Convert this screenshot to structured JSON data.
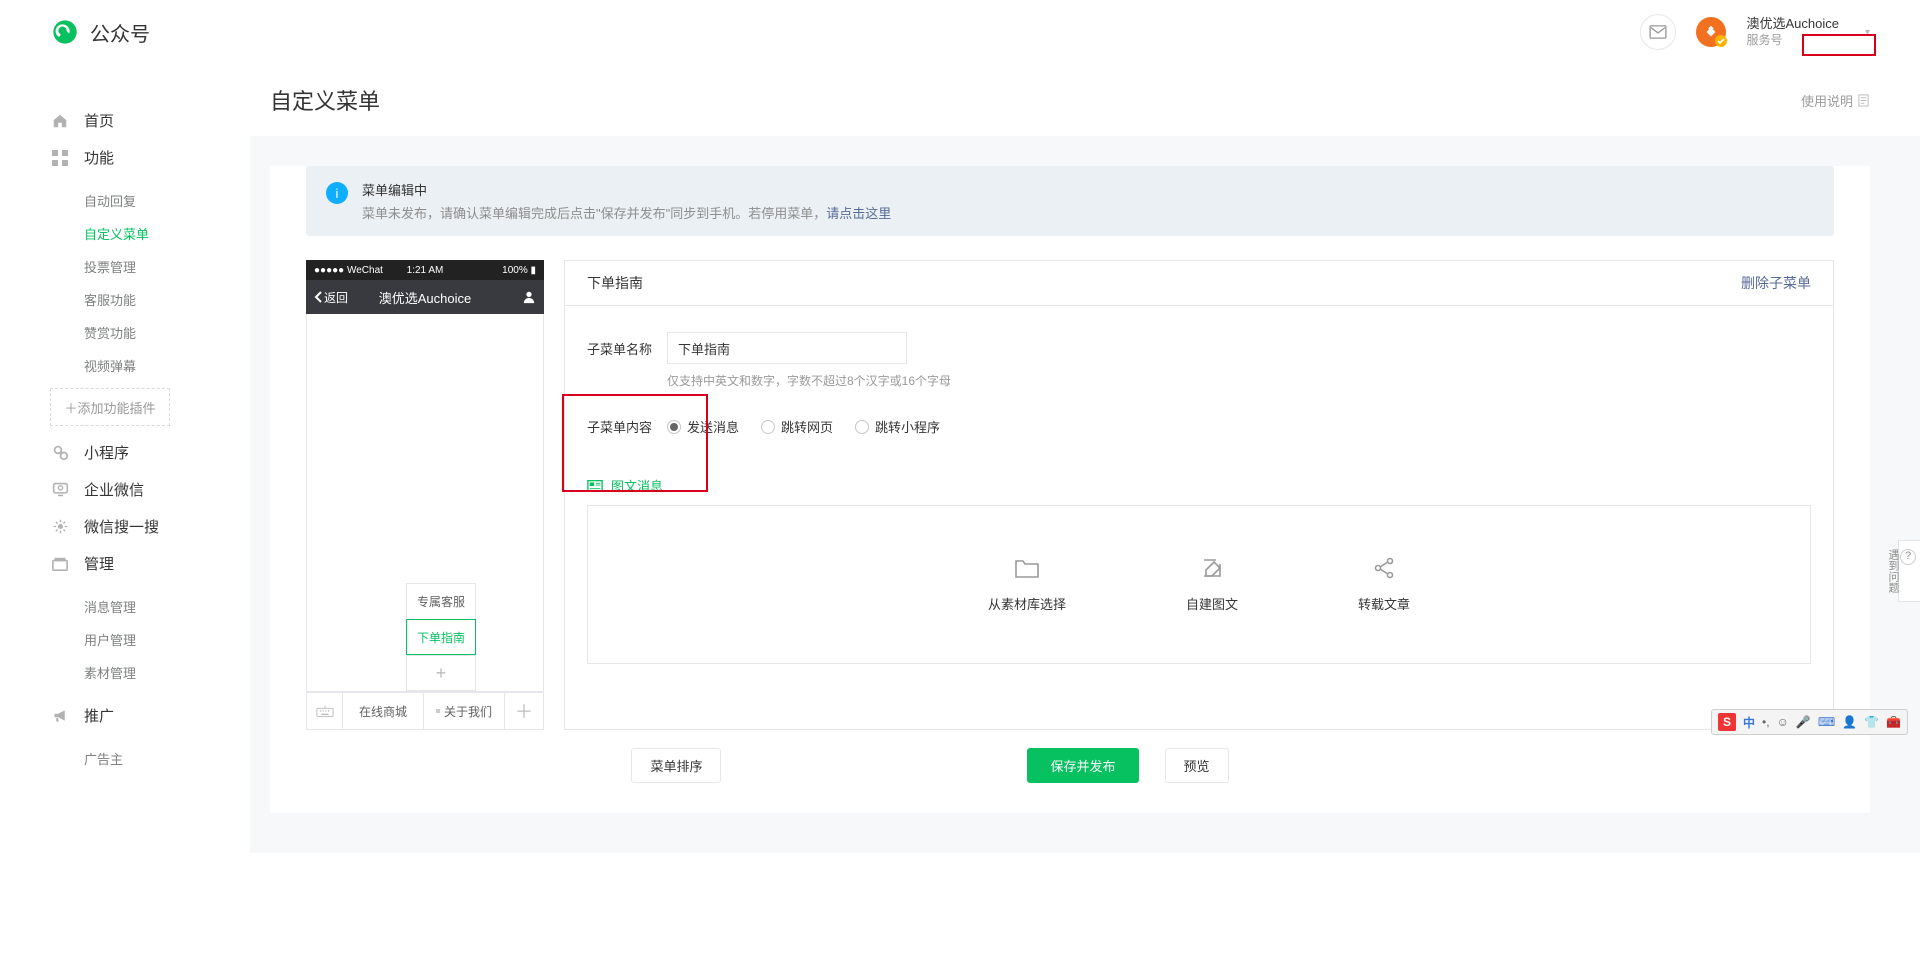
{
  "brand": {
    "name": "公众号"
  },
  "user": {
    "name": "澳优选Auchoice",
    "type": "服务号"
  },
  "sidebar": {
    "home": "首页",
    "features": {
      "title": "功能",
      "items": [
        "自动回复",
        "自定义菜单",
        "投票管理",
        "客服功能",
        "赞赏功能",
        "视频弹幕"
      ],
      "active": 1,
      "add_plugin": "添加功能插件"
    },
    "items2": [
      {
        "label": "小程序"
      },
      {
        "label": "企业微信"
      },
      {
        "label": "微信搜一搜"
      }
    ],
    "manage": {
      "title": "管理",
      "items": [
        "消息管理",
        "用户管理",
        "素材管理"
      ]
    },
    "promote": {
      "title": "推广",
      "items": [
        "广告主"
      ]
    }
  },
  "page": {
    "title": "自定义菜单",
    "help": "使用说明"
  },
  "notice": {
    "title": "菜单编辑中",
    "desc": "菜单未发布，请确认菜单编辑完成后点击\"保存并发布\"同步到手机。若停用菜单，",
    "link": "请点击这里"
  },
  "phone": {
    "carrier": "WeChat",
    "time": "1:21 AM",
    "battery": "100%",
    "back": "返回",
    "title": "澳优选Auchoice",
    "submenus": [
      "专属客服",
      "下单指南",
      "+"
    ],
    "tabs": [
      "在线商城",
      "关于我们"
    ]
  },
  "panel": {
    "title": "下单指南",
    "delete": "删除子菜单",
    "name_label": "子菜单名称",
    "name_value": "下单指南",
    "name_hint": "仅支持中英文和数字，字数不超过8个汉字或16个字母",
    "content_label": "子菜单内容",
    "radios": [
      "发送消息",
      "跳转网页",
      "跳转小程序"
    ],
    "msg_tab": "图文消息",
    "select_opts": [
      "从素材库选择",
      "自建图文",
      "转载文章"
    ]
  },
  "footer": {
    "sort": "菜单排序",
    "save": "保存并发布",
    "preview": "预览"
  },
  "sidetool": {
    "txt": "遇到问题"
  },
  "ime": {
    "txt": "中"
  }
}
